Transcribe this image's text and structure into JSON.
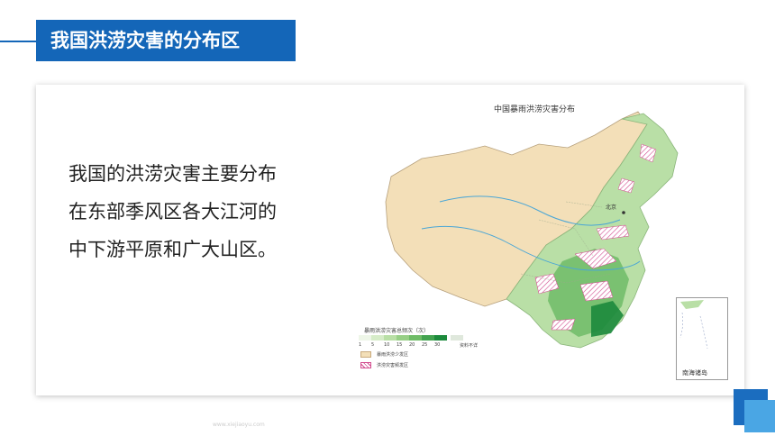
{
  "header": {
    "title": "我国洪涝灾害的分布区"
  },
  "content": {
    "lines": [
      "我国的洪涝灾害主要分布",
      "在东部季风区各大江河的",
      "中下游平原和广大山区。"
    ]
  },
  "map": {
    "title": "中国暴雨洪涝灾害分布",
    "beijing_label": "北京",
    "inset_label": "南海诸岛",
    "legend": {
      "title": "暴雨洪涝灾害总频次（次）",
      "scale_ticks": [
        "1",
        "5",
        "10",
        "15",
        "20",
        "25",
        "30"
      ],
      "no_data_label": "资料不详",
      "rare_label": "暴雨洪涝少发区",
      "frequent_label": "洪涝灾害频发区"
    },
    "colors": {
      "rare_area": "#f3dfb8",
      "frequent_hatch": "#d24b8e",
      "scale": [
        "#eef6e8",
        "#d6ecc8",
        "#b9dfa6",
        "#97cf86",
        "#6fbc67",
        "#43a350",
        "#1c8a3c"
      ]
    }
  },
  "watermark": "www.xiejiaoyu.com",
  "accent_color": "#1466b8"
}
